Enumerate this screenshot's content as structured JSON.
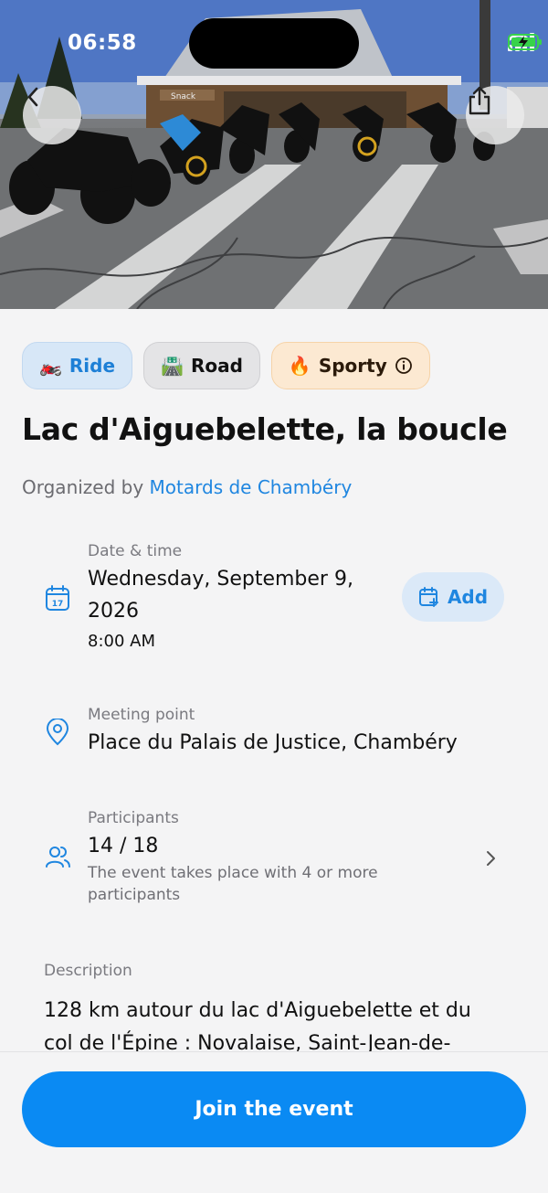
{
  "status_bar": {
    "time": "06:58"
  },
  "hero": {
    "image_alt": "Motorcycles parked in front of a mountain snack bar",
    "sign_text": "Snack"
  },
  "nav": {
    "back_icon": "chevron-left-icon",
    "share_icon": "share-icon"
  },
  "tags": [
    {
      "emoji": "🏍️",
      "label": "Ride"
    },
    {
      "emoji": "🛣️",
      "label": "Road"
    },
    {
      "emoji": "🔥",
      "label": "Sporty",
      "info_icon": "info-icon"
    }
  ],
  "event": {
    "title": "Lac d'Aiguebelette, la boucle",
    "organizer_prefix": "Organized by",
    "organizer_name": "Motards de Chambéry"
  },
  "date": {
    "label": "Date & time",
    "line1": "Wednesday, September 9,",
    "line2": "2026",
    "time": "8:00 AM",
    "calendar_day": "17",
    "add_label": "Add"
  },
  "meeting": {
    "label": "Meeting point",
    "value": "Place du Palais de Justice, Chambéry"
  },
  "participants": {
    "label": "Participants",
    "value": "14 / 18",
    "note_line1": "The event takes place with 4 or more",
    "note_line2": "participants"
  },
  "description": {
    "label": "Description",
    "line1": "128 km autour du lac d'Aiguebelette et du",
    "line2": "col de l'Épine : Novalaise, Saint-Jean-de-"
  },
  "cta": {
    "join_label": "Join the event"
  },
  "colors": {
    "accent": "#0a8af3",
    "link": "#1f86e0",
    "background": "#f4f4f5"
  }
}
